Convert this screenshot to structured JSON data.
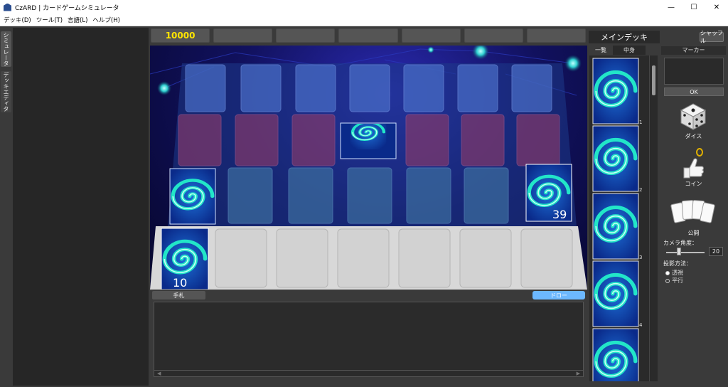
{
  "window": {
    "title": "CzARD | カードゲームシミュレータ",
    "controls": {
      "minimize": "—",
      "maximize": "☐",
      "close": "✕"
    }
  },
  "menu": [
    "デッキ(D)",
    "ツール(T)",
    "言語(L)",
    "ヘルプ(H)"
  ],
  "side_tabs": {
    "simulator": "シミュレータ",
    "deck_editor": "デッキエディタ"
  },
  "counters": [
    "10000",
    "",
    "",
    "",
    "",
    "",
    "",
    ""
  ],
  "board": {
    "main_deck_count": "39",
    "hand_deck_count": "10"
  },
  "hand": {
    "tab_label": "手札",
    "draw_button": "ドロー",
    "scroll_left": "◀",
    "scroll_right": "▶"
  },
  "deck_panel": {
    "title": "メインデッキ",
    "shuffle_button": "シャッフル",
    "tabs": [
      "一覧",
      "中身"
    ],
    "card_numbers": [
      "1",
      "2",
      "3",
      "4"
    ]
  },
  "tools": {
    "marker_label": "マーカー",
    "ok_button": "OK",
    "dice_label": "ダイス",
    "coin_label": "コイン",
    "reveal_label": "公開",
    "camera_angle_label": "カメラ角度：",
    "camera_angle_value": "20",
    "camera_angle_slider": 0.3,
    "projection_label": "投影方法：",
    "projection_options": [
      "透視",
      "平行"
    ],
    "projection_selected": "透視"
  },
  "colors": {
    "counter_text": "#ffe500",
    "draw_button": "#6cb8ff",
    "board_bg": "#11115e",
    "slot_blue": "#4a6fc8",
    "slot_red": "#8a3a6a",
    "mat_light": "#d8d8d8"
  }
}
